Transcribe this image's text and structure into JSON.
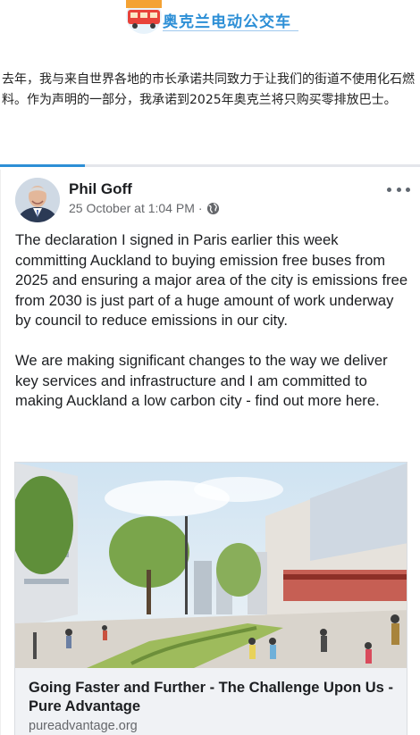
{
  "banner": {
    "title": "奥克兰电动公交车",
    "logo_icon": "bus-logo-icon",
    "accent": "#2d8fd6"
  },
  "intro": {
    "text": "去年，我与来自世界各地的市长承诺共同致力于让我们的街道不使用化石燃料。作为声明的一部分，我承诺到2025年奥克兰将只购买零排放巴士。"
  },
  "post": {
    "author": "Phil Goff",
    "timestamp": "25 October at 1:04 PM",
    "separator": "·",
    "privacy_icon": "globe-icon",
    "more_icon": "more-options-icon",
    "paragraphs": [
      "The declaration I signed in Paris earlier this week committing Auckland to buying emission free buses from 2025 and ensuring a major area of the city is emissions free from 2030 is just part of a huge amount of work underway by council to reduce emissions in our city.",
      "We are making significant changes to the way we deliver key services and infrastructure and I am committed to making Auckland a low carbon city - find out more here."
    ],
    "link": {
      "title": "Going Faster and Further - The Challenge Upon Us - Pure Advantage",
      "domain": "pureadvantage.org"
    }
  }
}
